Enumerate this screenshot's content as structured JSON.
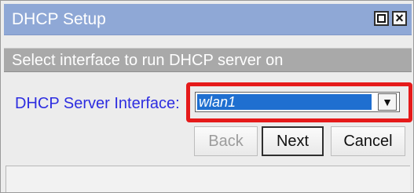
{
  "window": {
    "title": "DHCP Setup",
    "subheader": "Select interface to run DHCP server on"
  },
  "form": {
    "label": "DHCP Server Interface:",
    "selected_value": "wlan1"
  },
  "buttons": {
    "back": "Back",
    "next": "Next",
    "cancel": "Cancel"
  },
  "icons": {
    "maximize": "maximize-icon",
    "close": "close-icon",
    "dropdown": "dropdown-arrow-icon"
  },
  "colors": {
    "titlebar": "#8fa8d6",
    "subheader": "#a9a9a9",
    "label": "#2d2de0",
    "highlight": "#e51a1a",
    "selection": "#1f6fd0"
  }
}
